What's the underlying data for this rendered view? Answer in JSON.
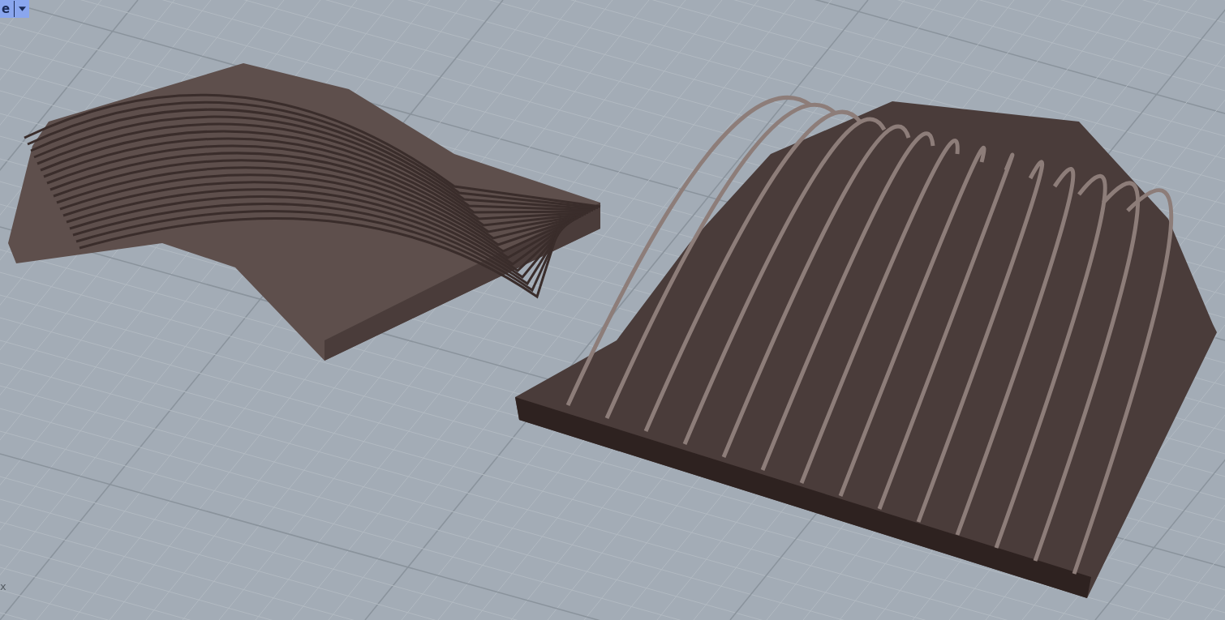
{
  "viewport": {
    "tab": {
      "label": "e"
    },
    "axis_label": "x"
  }
}
